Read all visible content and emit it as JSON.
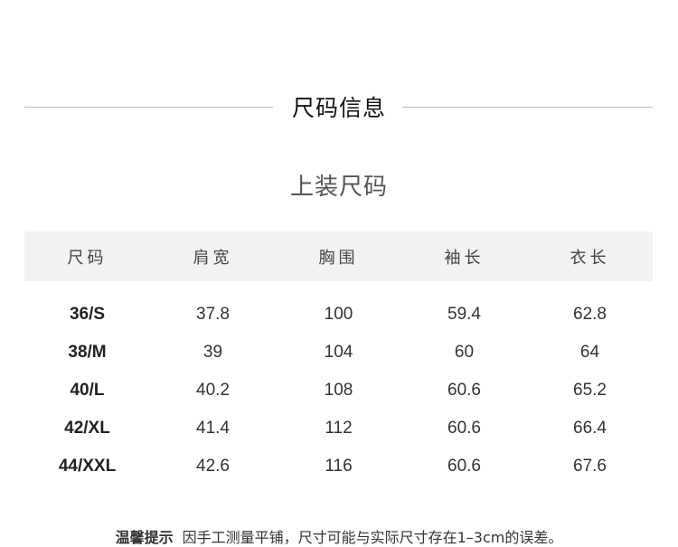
{
  "title": "尺码信息",
  "subtitle": "上装尺码",
  "table": {
    "headers": [
      "尺码",
      "肩宽",
      "胸围",
      "袖长",
      "衣长"
    ],
    "rows": [
      [
        "36/S",
        "37.8",
        "100",
        "59.4",
        "62.8"
      ],
      [
        "38/M",
        "39",
        "104",
        "60",
        "64"
      ],
      [
        "40/L",
        "40.2",
        "108",
        "60.6",
        "65.2"
      ],
      [
        "42/XL",
        "41.4",
        "112",
        "60.6",
        "66.4"
      ],
      [
        "44/XXL",
        "42.6",
        "116",
        "60.6",
        "67.6"
      ]
    ]
  },
  "footer": {
    "label": "温馨提示",
    "text": "因手工测量平铺，尺寸可能与实际尺寸存在1–3cm的误差。"
  }
}
